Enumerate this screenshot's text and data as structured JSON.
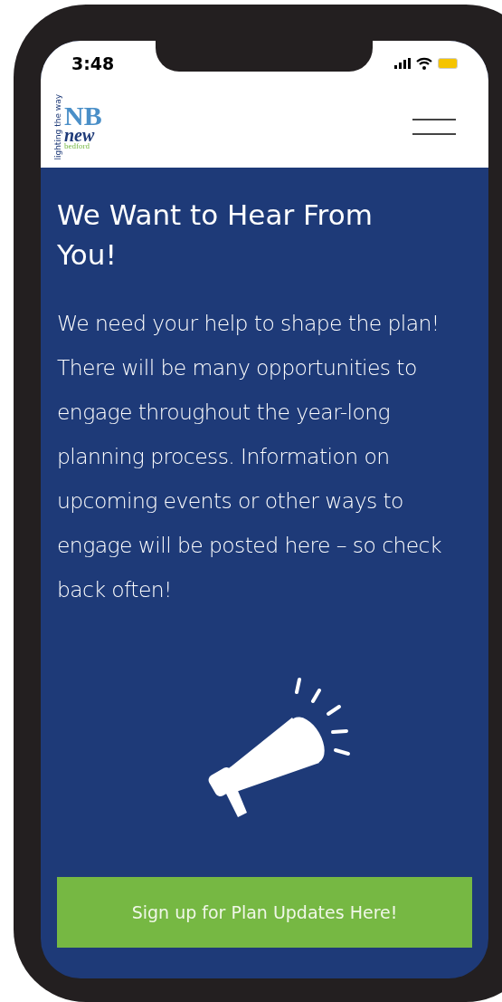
{
  "status_bar": {
    "time": "3:48"
  },
  "header": {
    "logo": {
      "mark": "NB",
      "word": "new",
      "town": "bedford",
      "tagline": "lighting the way"
    }
  },
  "hero": {
    "title": "We Want to Hear From You!",
    "body": "We need your help to shape the plan! There will be many opportunities to engage throughout the year-long planning process. Information on upcoming events or other ways to engage will be posted here – so check back often!"
  },
  "signup_button": {
    "label": "Sign up for Plan Updates Here!"
  }
}
